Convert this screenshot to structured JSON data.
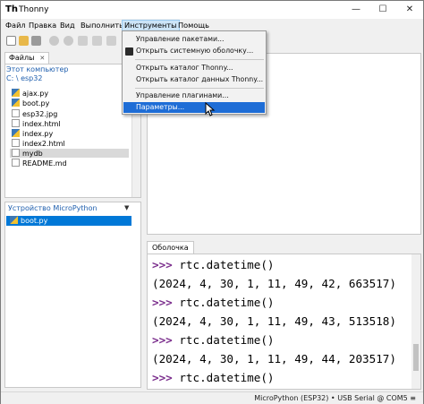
{
  "window": {
    "title": "Thonny"
  },
  "menubar": [
    "Файл",
    "Правка",
    "Вид",
    "Выполнить",
    "Инструменты",
    "Помощь"
  ],
  "dropdown": {
    "items": [
      "Управление пакетами...",
      "Открыть системную оболочку...",
      "Открыть каталог Thonny...",
      "Открыть каталог данных Thonny...",
      "Управление плагинами...",
      "Параметры..."
    ]
  },
  "files_pane": {
    "tab_label": "Файлы",
    "header": "Этот компьютер",
    "path": "C: \\ esp32",
    "files": [
      "ajax.py",
      "boot.py",
      "esp32.jpg",
      "index.html",
      "index.py",
      "index2.html",
      "mydb",
      "README.md"
    ]
  },
  "device_pane": {
    "title": "Устройство MicroPython",
    "files": [
      "boot.py"
    ]
  },
  "shell": {
    "tab_label": "Оболочка",
    "prompt": ">>>",
    "lines": [
      {
        "prompt": true,
        "text": " rtc.datetime()"
      },
      {
        "prompt": false,
        "text": "(2024, 4, 30, 1, 11, 49, 42, 663517)"
      },
      {
        "prompt": true,
        "text": " rtc.datetime()"
      },
      {
        "prompt": false,
        "text": "(2024, 4, 30, 1, 11, 49, 43, 513518)"
      },
      {
        "prompt": true,
        "text": " rtc.datetime()"
      },
      {
        "prompt": false,
        "text": "(2024, 4, 30, 1, 11, 49, 44, 203517)"
      },
      {
        "prompt": true,
        "text": " rtc.datetime()"
      }
    ]
  },
  "statusbar": {
    "text": "MicroPython (ESP32)  •  USB Serial @ COM5  ≡"
  },
  "colors": {
    "selection": "#0078d7",
    "menu_highlight": "#1e6dd6",
    "prompt": "#7a2d8c"
  }
}
